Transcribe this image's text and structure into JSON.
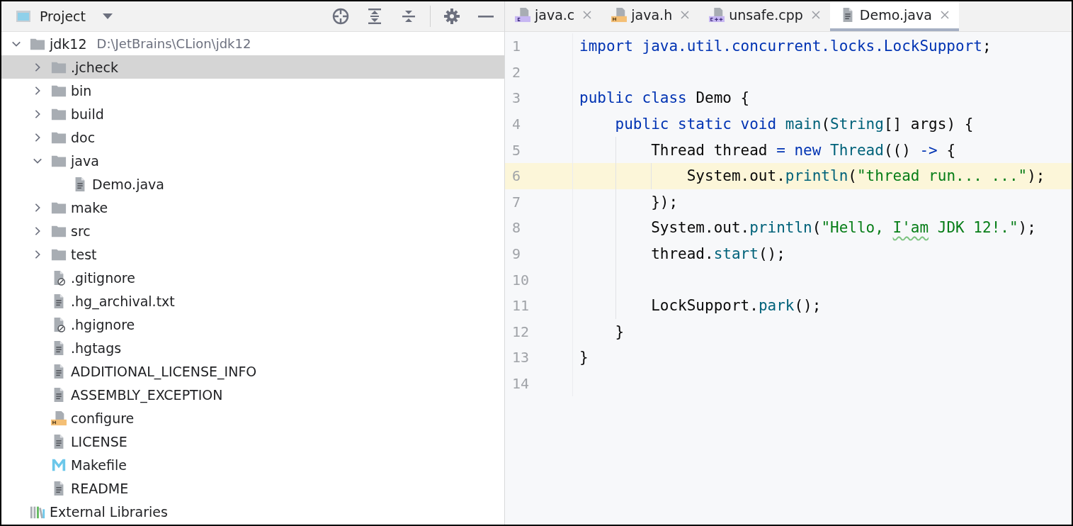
{
  "project_panel": {
    "title": "Project",
    "tree": [
      {
        "name": "jdk12",
        "path": "D:\\JetBrains\\CLion\\jdk12",
        "kind": "folder",
        "expanded": true,
        "selected": false,
        "children": [
          {
            "name": ".jcheck",
            "kind": "folder",
            "expanded": false,
            "selected": true
          },
          {
            "name": "bin",
            "kind": "folder",
            "expanded": false,
            "selected": false
          },
          {
            "name": "build",
            "kind": "folder",
            "expanded": false,
            "selected": false
          },
          {
            "name": "doc",
            "kind": "folder",
            "expanded": false,
            "selected": false
          },
          {
            "name": "java",
            "kind": "folder",
            "expanded": true,
            "selected": false,
            "children": [
              {
                "name": "Demo.java",
                "kind": "text",
                "selected": false
              }
            ]
          },
          {
            "name": "make",
            "kind": "folder",
            "expanded": false,
            "selected": false
          },
          {
            "name": "src",
            "kind": "folder",
            "expanded": false,
            "selected": false
          },
          {
            "name": "test",
            "kind": "folder",
            "expanded": false,
            "selected": false
          },
          {
            "name": ".gitignore",
            "kind": "ignored",
            "selected": false
          },
          {
            "name": ".hg_archival.txt",
            "kind": "text",
            "selected": false
          },
          {
            "name": ".hgignore",
            "kind": "ignored",
            "selected": false
          },
          {
            "name": ".hgtags",
            "kind": "text",
            "selected": false
          },
          {
            "name": "ADDITIONAL_LICENSE_INFO",
            "kind": "text",
            "selected": false
          },
          {
            "name": "ASSEMBLY_EXCEPTION",
            "kind": "text",
            "selected": false
          },
          {
            "name": "configure",
            "kind": "header",
            "selected": false
          },
          {
            "name": "LICENSE",
            "kind": "text",
            "selected": false
          },
          {
            "name": "Makefile",
            "kind": "makefile",
            "selected": false
          },
          {
            "name": "README",
            "kind": "text",
            "selected": false
          }
        ]
      },
      {
        "name": "External Libraries",
        "kind": "libraries",
        "selected": false
      }
    ]
  },
  "editor": {
    "tabs": [
      {
        "label": "java.c",
        "kind": "c",
        "selected": false
      },
      {
        "label": "java.h",
        "kind": "h",
        "selected": false
      },
      {
        "label": "unsafe.cpp",
        "kind": "cpp",
        "selected": false
      },
      {
        "label": "Demo.java",
        "kind": "java",
        "selected": true
      }
    ],
    "lines": [
      {
        "number": "1",
        "current": false,
        "tokens": [
          {
            "text": "import java.util.concurrent.locks.LockSupport",
            "kind": "keyword"
          },
          {
            "text": ";",
            "kind": "plain"
          }
        ]
      },
      {
        "number": "2",
        "current": false
      },
      {
        "number": "3",
        "current": false,
        "tokens": [
          {
            "text": "public class ",
            "kind": "keyword"
          },
          {
            "text": "Demo {",
            "kind": "plain"
          }
        ]
      },
      {
        "number": "4",
        "current": false,
        "tokens": [
          {
            "text": "    public static void ",
            "kind": "keyword"
          },
          {
            "text": "main",
            "kind": "method"
          },
          {
            "text": "(",
            "kind": "plain"
          },
          {
            "text": "String",
            "kind": "method"
          },
          {
            "text": "[] args) {",
            "kind": "plain"
          }
        ]
      },
      {
        "number": "5",
        "current": false,
        "tokens": [
          {
            "text": "        Thread thread ",
            "kind": "plain"
          },
          {
            "text": "= new ",
            "kind": "keyword"
          },
          {
            "text": "Thread",
            "kind": "method"
          },
          {
            "text": "(() ",
            "kind": "plain"
          },
          {
            "text": "->",
            "kind": "keyword"
          },
          {
            "text": " {",
            "kind": "plain"
          }
        ]
      },
      {
        "number": "6",
        "current": true,
        "tokens": [
          {
            "text": "            System.out.",
            "kind": "plain"
          },
          {
            "text": "println",
            "kind": "method"
          },
          {
            "text": "(",
            "kind": "plain"
          },
          {
            "text": "\"thread run... ...\"",
            "kind": "string"
          },
          {
            "text": ");",
            "kind": "plain"
          }
        ]
      },
      {
        "number": "7",
        "current": false,
        "tokens": [
          {
            "text": "        });",
            "kind": "plain"
          }
        ]
      },
      {
        "number": "8",
        "current": false,
        "tokens": [
          {
            "text": "        System.out.",
            "kind": "plain"
          },
          {
            "text": "println",
            "kind": "method"
          },
          {
            "text": "(",
            "kind": "plain"
          },
          {
            "text": "\"Hello, ",
            "kind": "string"
          },
          {
            "text": "I'am",
            "kind": "typo"
          },
          {
            "text": " JDK 12!.\"",
            "kind": "string"
          },
          {
            "text": ");",
            "kind": "plain"
          }
        ]
      },
      {
        "number": "9",
        "current": false,
        "tokens": [
          {
            "text": "        thread.",
            "kind": "plain"
          },
          {
            "text": "start",
            "kind": "method"
          },
          {
            "text": "();",
            "kind": "plain"
          }
        ]
      },
      {
        "number": "10",
        "current": false
      },
      {
        "number": "11",
        "current": false,
        "tokens": [
          {
            "text": "        LockSupport.",
            "kind": "plain"
          },
          {
            "text": "park",
            "kind": "method"
          },
          {
            "text": "();",
            "kind": "plain"
          }
        ]
      },
      {
        "number": "12",
        "current": false,
        "tokens": [
          {
            "text": "    }",
            "kind": "plain"
          }
        ]
      },
      {
        "number": "13",
        "current": false,
        "tokens": [
          {
            "text": "}",
            "kind": "plain"
          }
        ]
      },
      {
        "number": "14",
        "current": false
      }
    ]
  }
}
